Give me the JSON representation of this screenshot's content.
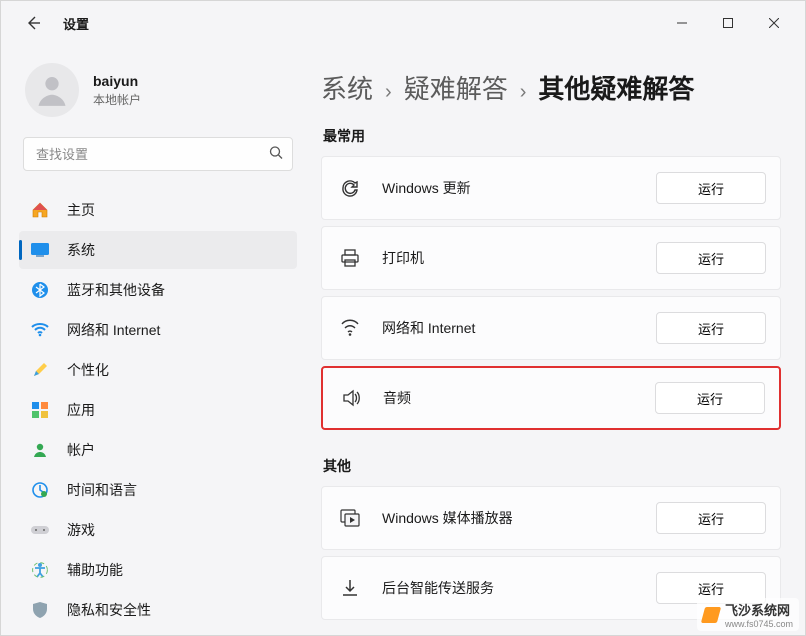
{
  "window": {
    "app_title": "设置"
  },
  "profile": {
    "name": "baiyun",
    "subtitle": "本地帐户"
  },
  "search": {
    "placeholder": "查找设置"
  },
  "nav": {
    "items": [
      {
        "label": "主页"
      },
      {
        "label": "系统"
      },
      {
        "label": "蓝牙和其他设备"
      },
      {
        "label": "网络和 Internet"
      },
      {
        "label": "个性化"
      },
      {
        "label": "应用"
      },
      {
        "label": "帐户"
      },
      {
        "label": "时间和语言"
      },
      {
        "label": "游戏"
      },
      {
        "label": "辅助功能"
      },
      {
        "label": "隐私和安全性"
      }
    ]
  },
  "breadcrumb": {
    "items": [
      "系统",
      "疑难解答",
      "其他疑难解答"
    ]
  },
  "sections": {
    "frequent_title": "最常用",
    "other_title": "其他"
  },
  "troubleshooters": {
    "frequent": [
      {
        "label": "Windows 更新",
        "run": "运行"
      },
      {
        "label": "打印机",
        "run": "运行"
      },
      {
        "label": "网络和 Internet",
        "run": "运行"
      },
      {
        "label": "音频",
        "run": "运行"
      }
    ],
    "other": [
      {
        "label": "Windows 媒体播放器",
        "run": "运行"
      },
      {
        "label": "后台智能传送服务",
        "run": "运行"
      }
    ]
  },
  "watermark": {
    "name": "飞沙系统网",
    "url": "www.fs0745.com"
  }
}
